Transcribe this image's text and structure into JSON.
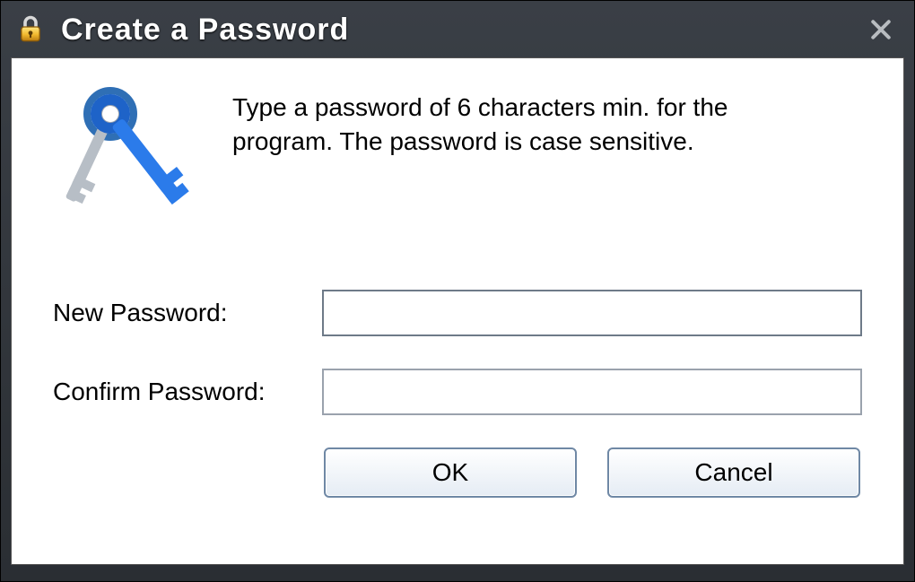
{
  "titlebar": {
    "title": "Create a Password",
    "icon": "padlock-icon",
    "close": "close-icon"
  },
  "dialog": {
    "instructions": "Type a password of 6 characters min. for the program. The password is case sensitive.",
    "fields": {
      "new_password_label": "New Password:",
      "new_password_value": "",
      "confirm_password_label": "Confirm Password:",
      "confirm_password_value": ""
    },
    "buttons": {
      "ok": "OK",
      "cancel": "Cancel"
    }
  }
}
